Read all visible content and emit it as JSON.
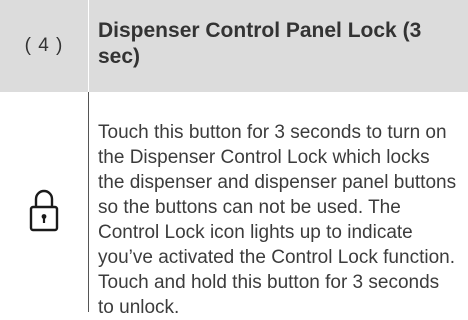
{
  "step": {
    "number": "( 4 )",
    "title": "Dispenser Control Panel Lock (3 sec)"
  },
  "icon": {
    "name": "padlock-icon"
  },
  "description": "Touch this button for 3 seconds to turn on the Dispenser Control Lock which locks the dispenser and dispenser panel buttons so the buttons can not be used. The Control Lock icon lights up to indicate you’ve activated the Control Lock function. Touch and hold this button for 3 seconds to unlock.",
  "colors": {
    "header_background": "#dcdcdc",
    "text": "#3c3c3c"
  }
}
